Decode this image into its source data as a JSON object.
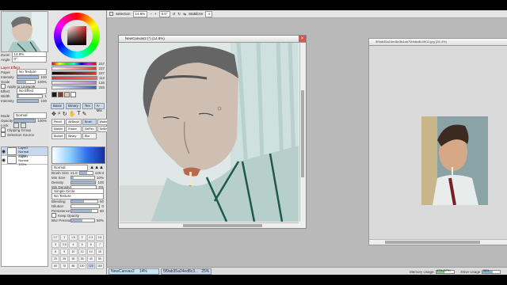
{
  "toolbar": {
    "selection_label": "Selection",
    "zoom": "14.8%",
    "rotation": "0.0°",
    "stabilizer_label": "Stabilizer",
    "stabilizer_value": "4"
  },
  "navigator": {
    "zoom_label": "Zoom",
    "zoom_value": "14.8%",
    "angle_label": "Angle",
    "angle_value": "0°"
  },
  "color_sliders": {
    "values": [
      "237",
      "237",
      "237",
      "112",
      "136",
      "255"
    ]
  },
  "layer_effect": {
    "header": "Layer Effect",
    "paper_label": "Paper",
    "paper_value": "No Texture",
    "intensity_label": "Intensity",
    "intensity_value": "100",
    "scale_label": "Scale",
    "scale_value": "100%",
    "apply_linework": "Apply to Linework",
    "effect_label": "Effect",
    "effect_value": "No Effect",
    "width_label": "Width",
    "width_value": "1",
    "effect_intensity_label": "Intensity",
    "effect_intensity_value": "100"
  },
  "layer_props": {
    "mode_label": "Mode",
    "mode_value": "Normal",
    "opacity_label": "Opacity",
    "opacity_value": "100%",
    "lock_label": "Lock",
    "clipping_label": "Clipping Group",
    "selection_source_label": "Selection Source"
  },
  "layers": [
    {
      "name": "Layer2",
      "mode": "Normal",
      "opacity": "100%"
    },
    {
      "name": "Layer1",
      "mode": "Normal",
      "opacity": "100%"
    }
  ],
  "brush_tabs": [
    "Basic",
    "Binary",
    "Tex",
    "A-Mix",
    "A-Water"
  ],
  "tools": [
    {
      "label": "Pencil"
    },
    {
      "label": "AirBrush"
    },
    {
      "label": "Brush"
    },
    {
      "label": "Water"
    },
    {
      "label": "Marker"
    },
    {
      "label": "Eraser"
    },
    {
      "label": "SelPen"
    },
    {
      "label": "SelErs"
    },
    {
      "label": "Bucket"
    },
    {
      "label": "Binary"
    },
    {
      "label": "Blur"
    }
  ],
  "brush_settings": {
    "blend_mode": "Normal",
    "brush_size_label": "Brush Size",
    "brush_size_multiplier": "x1.0",
    "brush_size_value": "120.0",
    "min_size_label": "Min Size",
    "min_size_value": "10%",
    "density_label": "Density",
    "density_value": "100",
    "min_density_label": "Min Density",
    "min_density_value": "0%",
    "circle_label": "Simple Circle",
    "texture_label": "No Texture",
    "blending_label": "Blending",
    "blending_value": "50",
    "dilution_label": "Dilution",
    "dilution_value": "0",
    "persistence_label": "Persistence",
    "persistence_value": "80",
    "keep_opacity_label": "Keep Opacity",
    "blur_pressure_label": "Blur Pressure",
    "blur_pressure_value": "50%"
  },
  "size_grid": [
    "0.7",
    "1",
    "1.5",
    "2",
    "2.3",
    "2.6",
    "3",
    "3.5",
    "4",
    "5",
    "6",
    "7",
    "8",
    "9",
    "10",
    "12",
    "14",
    "16",
    "20",
    "25",
    "30",
    "35",
    "40",
    "50",
    "60",
    "70",
    "80",
    "100",
    "120",
    "160"
  ],
  "canvas_window": {
    "title": "NewCanvas2 (*) (14.8%)"
  },
  "reference_window": {
    "title": "5f9ab35a24ed8c3b4ab70bb6c8b4f011.jpg (25.4%)"
  },
  "status": {
    "doc1_name": "NewCanvas2",
    "doc1_zoom": "14%",
    "doc2_name": "5f9ab35a24ed8c3...",
    "doc2_zoom": "25%",
    "memory_label": "Memory Usage",
    "memory_value": "47% (57%)",
    "memory_fraction": 0.47,
    "drive_label": "Drive Usage",
    "drive_value": "58%",
    "drive_fraction": 0.58
  },
  "colors": {
    "accent": "#9db7d8",
    "close": "#d9534f",
    "workspace": "#b9b9b9"
  }
}
